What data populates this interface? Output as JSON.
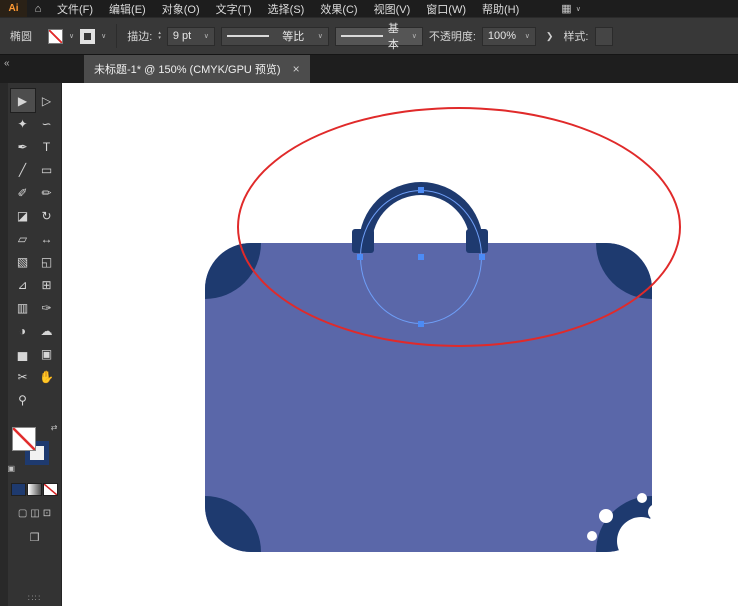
{
  "menubar": {
    "logo_text": "Ai",
    "home_icon": "⌂",
    "items": [
      "文件(F)",
      "编辑(E)",
      "对象(O)",
      "文字(T)",
      "选择(S)",
      "效果(C)",
      "视图(V)",
      "窗口(W)",
      "帮助(H)"
    ],
    "workspace_icon": "▦",
    "caret": "∨"
  },
  "controlbar": {
    "tool_label": "椭圆",
    "stroke_label": "描边:",
    "stroke_value": "9 pt",
    "profile_value": "等比",
    "brush_value": "基本",
    "opacity_label": "不透明度:",
    "opacity_value": "100%",
    "style_label": "样式:",
    "caret": "∨",
    "up": "▴",
    "down": "▾",
    "expand": "❯"
  },
  "tabbar": {
    "collapse_icon": "«",
    "title": "未标题-1* @ 150% (CMYK/GPU 预览)",
    "close_icon": "×"
  },
  "toolbar": {
    "tools": [
      {
        "name": "selection-tool",
        "glyph": "▶",
        "active": true
      },
      {
        "name": "direct-selection-tool",
        "glyph": "▷",
        "active": false
      },
      {
        "name": "magic-wand-tool",
        "glyph": "✦",
        "active": false
      },
      {
        "name": "lasso-tool",
        "glyph": "∽",
        "active": false
      },
      {
        "name": "pen-tool",
        "glyph": "✒",
        "active": false
      },
      {
        "name": "type-tool",
        "glyph": "T",
        "active": false
      },
      {
        "name": "line-segment-tool",
        "glyph": "╱",
        "active": false
      },
      {
        "name": "rectangle-tool",
        "glyph": "▭",
        "active": false
      },
      {
        "name": "paintbrush-tool",
        "glyph": "✐",
        "active": false
      },
      {
        "name": "pencil-tool",
        "glyph": "✏",
        "active": false
      },
      {
        "name": "eraser-tool",
        "glyph": "◪",
        "active": false
      },
      {
        "name": "rotate-tool",
        "glyph": "↻",
        "active": false
      },
      {
        "name": "scale-tool",
        "glyph": "▱",
        "active": false
      },
      {
        "name": "width-tool",
        "glyph": "↔",
        "active": false
      },
      {
        "name": "free-transform-tool",
        "glyph": "▧",
        "active": false
      },
      {
        "name": "shape-builder-tool",
        "glyph": "◱",
        "active": false
      },
      {
        "name": "perspective-grid-tool",
        "glyph": "⊿",
        "active": false
      },
      {
        "name": "mesh-tool",
        "glyph": "⊞",
        "active": false
      },
      {
        "name": "gradient-tool",
        "glyph": "▥",
        "active": false
      },
      {
        "name": "eyedropper-tool",
        "glyph": "✑",
        "active": false
      },
      {
        "name": "blend-tool",
        "glyph": "◑",
        "active": false
      },
      {
        "name": "symbol-sprayer-tool",
        "glyph": "☁",
        "active": false
      },
      {
        "name": "column-graph-tool",
        "glyph": "▅",
        "active": false
      },
      {
        "name": "artboard-tool",
        "glyph": "▣",
        "active": false
      },
      {
        "name": "slice-tool",
        "glyph": "✂",
        "active": false
      },
      {
        "name": "hand-tool",
        "glyph": "✋",
        "active": false
      },
      {
        "name": "zoom-tool",
        "glyph": "⚲",
        "active": false
      }
    ],
    "swap_icon": "⇄",
    "default_swatch_icon": "▣",
    "modes": [
      {
        "name": "draw-normal-mode",
        "glyph": "▢"
      },
      {
        "name": "draw-behind-mode",
        "glyph": "◫"
      },
      {
        "name": "draw-inside-mode",
        "glyph": "⊡"
      }
    ],
    "screen_mode_icon": "❒",
    "overflow_icon": "∷∷"
  },
  "canvas": {
    "colors": {
      "suitcase_body": "#5A67A9",
      "suitcase_dark": "#1E3A6F",
      "red_stroke": "#E02A2A",
      "selection_blue": "#6E9EF7",
      "anchor_blue": "#4C8BF5",
      "watermark": "#FFFFFF"
    }
  }
}
